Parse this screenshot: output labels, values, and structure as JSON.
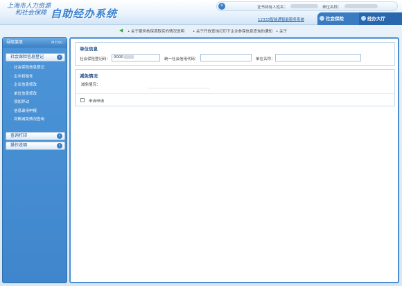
{
  "header": {
    "logo_line1": "上海市人力资源",
    "logo_line2": "和社会保障",
    "system_title": "自助经办系统",
    "user_label": "证书持有人姓名：",
    "unit_label": "单位名称：",
    "service_link": "12333智能通智能服务系统",
    "tabs": [
      {
        "label": "社会保险"
      },
      {
        "label": "经办大厅"
      }
    ]
  },
  "notice": {
    "items": [
      "关于服务核保调取实的情况说明",
      "关于开放查询打印下企业参保信息查询的通知",
      "关于"
    ]
  },
  "sidebar": {
    "title": "导航菜单",
    "menu_tag": "MENU",
    "section_main": "社会保险信息登记",
    "items": [
      {
        "label": "社会保险信息登记"
      },
      {
        "label": "企业初始化"
      },
      {
        "label": "企业信息修改"
      },
      {
        "label": "单位信息修改"
      },
      {
        "label": "添加异动"
      },
      {
        "label": "信息录用申报"
      },
      {
        "label": "到账减免情况查询"
      }
    ],
    "section_print": "查询打印",
    "section_help": "操作说明"
  },
  "unit_info": {
    "title": "单位信息",
    "code_label": "社会保险登记码：",
    "code_value": "0000",
    "credit_label": "统一社会信用代码：",
    "credit_value": "",
    "name_label": "单位名称：",
    "name_value": ""
  },
  "reduction": {
    "title": "减免情况",
    "status_label": "减免情况：",
    "apply_label": "申诉申请"
  },
  "colors": {
    "accent": "#3f86cc",
    "tab_blue": "#2866ad",
    "notice_arrow": "#2fa63a"
  }
}
